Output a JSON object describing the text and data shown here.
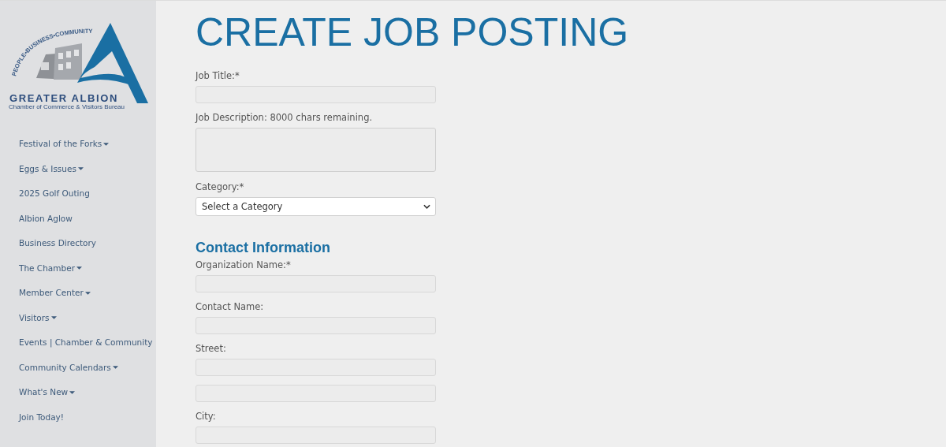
{
  "logo": {
    "tagline": "PEOPLE•BUSINESS•COMMUNITY",
    "name": "GREATER ALBION",
    "subtitle": "Chamber of Commerce & Visitors Bureau"
  },
  "sidebar": {
    "items": [
      {
        "label": "Festival of the Forks",
        "dropdown": true
      },
      {
        "label": "Eggs & Issues",
        "dropdown": true
      },
      {
        "label": "2025 Golf Outing",
        "dropdown": false
      },
      {
        "label": "Albion Aglow",
        "dropdown": false
      },
      {
        "label": "Business Directory",
        "dropdown": false
      },
      {
        "label": "The Chamber",
        "dropdown": true
      },
      {
        "label": "Member Center",
        "dropdown": true
      },
      {
        "label": "Visitors",
        "dropdown": true
      },
      {
        "label": "Events | Chamber & Community",
        "dropdown": false
      },
      {
        "label": "Community Calendars",
        "dropdown": true
      },
      {
        "label": "What's New",
        "dropdown": true
      },
      {
        "label": "Join Today!",
        "dropdown": false
      }
    ]
  },
  "page_title": "CREATE JOB POSTING",
  "form": [
    {
      "kind": "text",
      "label": "Job Title:*"
    },
    {
      "kind": "textarea",
      "label": "Job Description: 8000 chars remaining."
    },
    {
      "kind": "select",
      "label": "Category:*",
      "value": "Select a Category"
    },
    {
      "kind": "heading",
      "label": "Contact Information"
    },
    {
      "kind": "text",
      "label": "Organization Name:*"
    },
    {
      "kind": "text",
      "label": "Contact Name:"
    },
    {
      "kind": "text",
      "label": "Street:"
    },
    {
      "kind": "text"
    },
    {
      "kind": "text",
      "label": "City:"
    }
  ]
}
